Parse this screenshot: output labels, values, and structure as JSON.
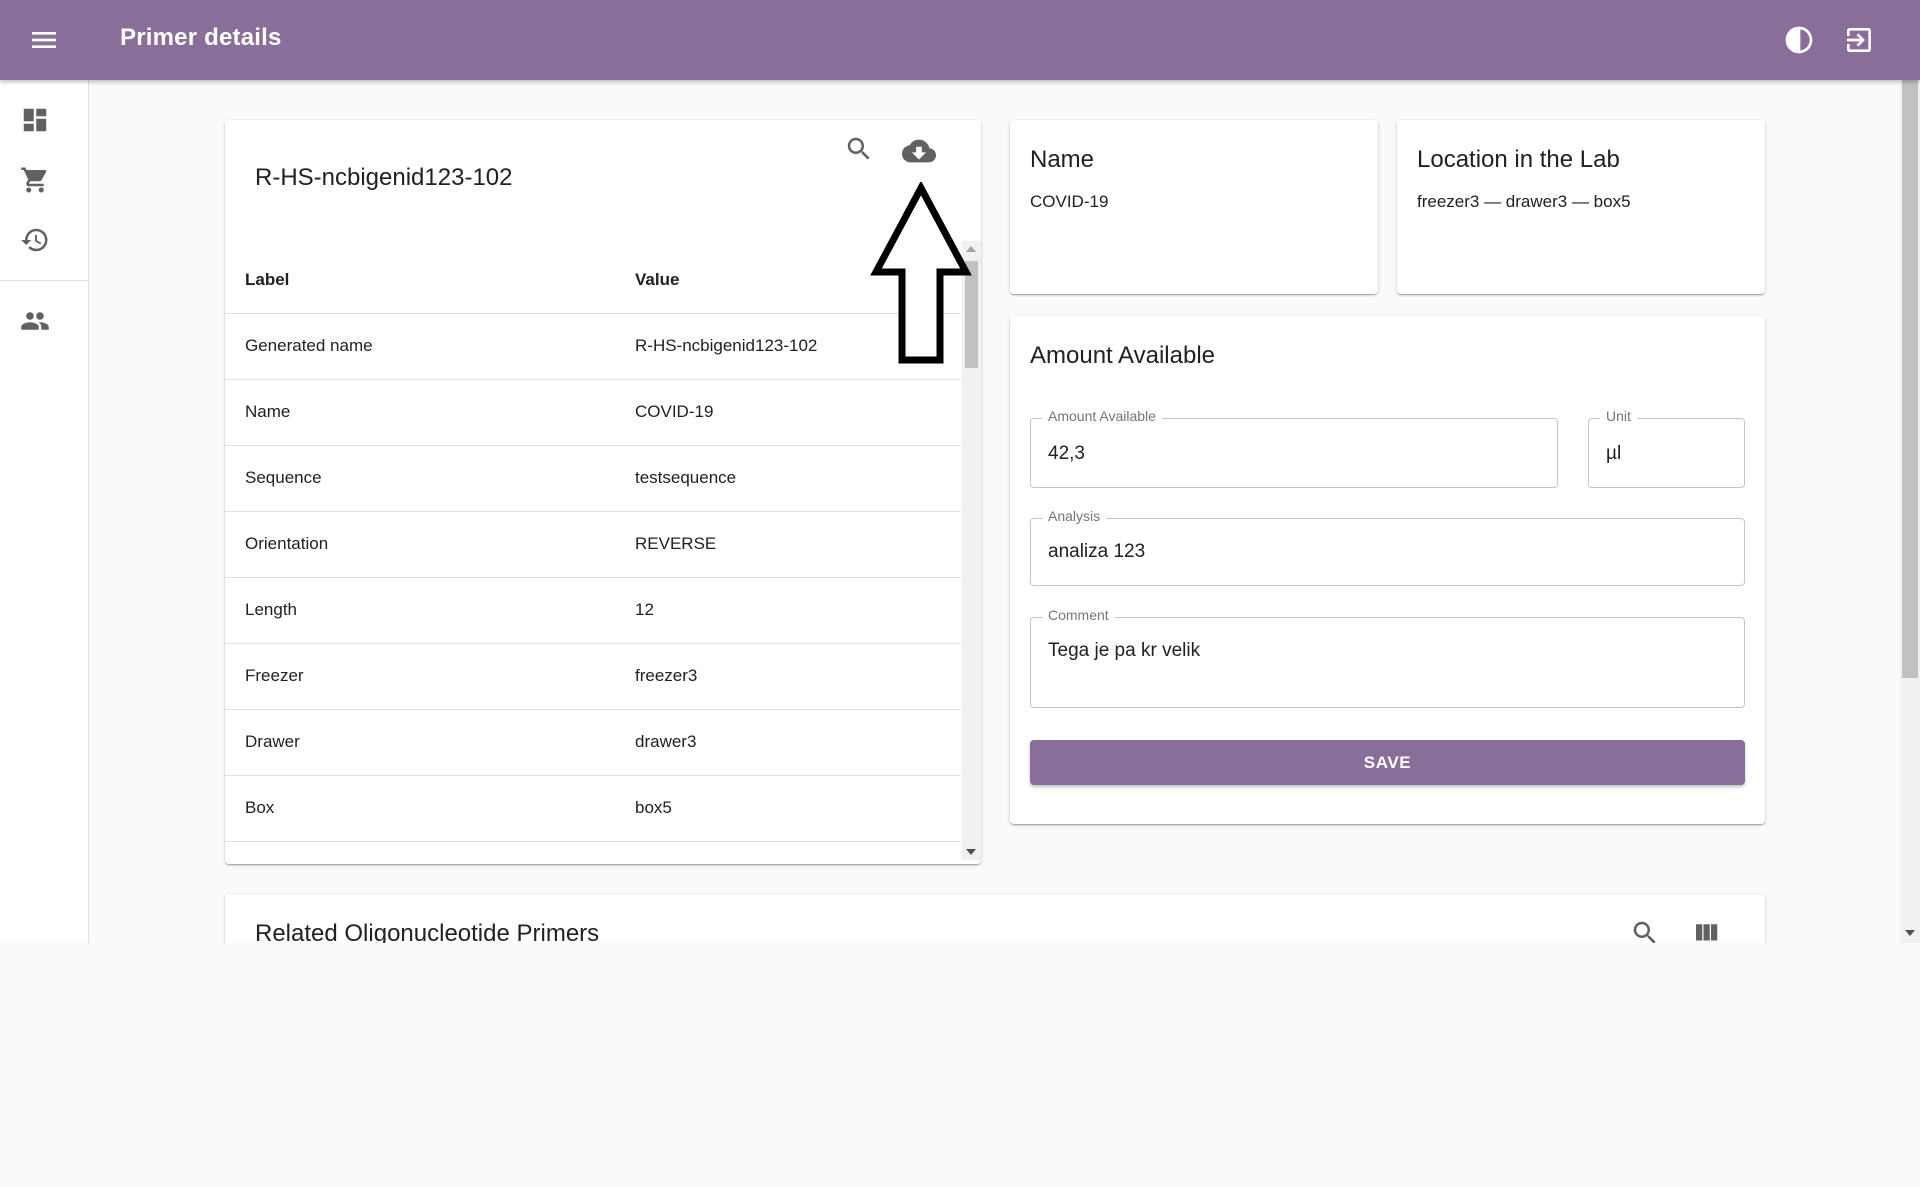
{
  "appbar": {
    "title": "Primer details",
    "background": "#8a6e9a"
  },
  "icons": {
    "menu": "menu-icon",
    "theme": "contrast-icon",
    "logout": "logout-icon",
    "dashboard": "dashboard-icon",
    "cart": "cart-icon",
    "history": "history-icon",
    "users": "people-icon",
    "search": "search-icon",
    "download": "cloud-download-icon",
    "columns": "view-columns-icon"
  },
  "detail": {
    "title": "R-HS-ncbigenid123-102",
    "table": {
      "headers": [
        "Label",
        "Value"
      ],
      "rows": [
        [
          "Generated name",
          "R-HS-ncbigenid123-102"
        ],
        [
          "Name",
          "COVID-19"
        ],
        [
          "Sequence",
          "testsequence"
        ],
        [
          "Orientation",
          "REVERSE"
        ],
        [
          "Length",
          "12"
        ],
        [
          "Freezer",
          "freezer3"
        ],
        [
          "Drawer",
          "drawer3"
        ],
        [
          "Box",
          "box5"
        ]
      ]
    }
  },
  "name_card": {
    "heading": "Name",
    "value": "COVID-19"
  },
  "location_card": {
    "heading": "Location in the Lab",
    "value": "freezer3 — drawer3 — box5"
  },
  "amount_card": {
    "heading": "Amount Available",
    "amount": {
      "label": "Amount Available",
      "value": "42,3"
    },
    "unit": {
      "label": "Unit",
      "value": "µl"
    },
    "analysis": {
      "label": "Analysis",
      "value": "analiza 123"
    },
    "comment": {
      "label": "Comment",
      "value": "Tega je pa kr velik"
    },
    "save_label": "SAVE"
  },
  "related": {
    "heading": "Related Oligonucleotide Primers"
  }
}
